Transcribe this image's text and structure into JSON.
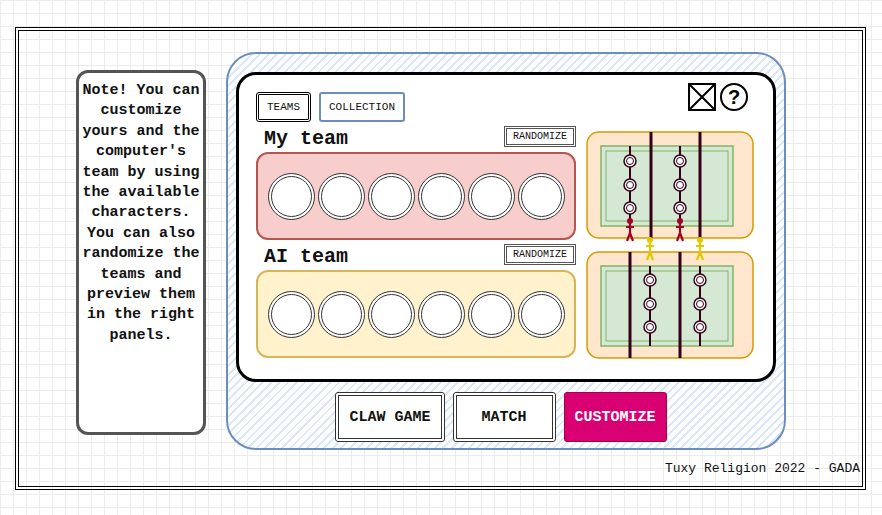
{
  "tabs": [
    {
      "label": "TEAMS",
      "selected": true
    },
    {
      "label": "COLLECTION",
      "selected": false
    }
  ],
  "help_button": "?",
  "note": "Note! You can customize yours and the computer's team by using the available characters. You can also randomize the teams and preview them in the right panels.",
  "teams": [
    {
      "title": "My team",
      "randomize": "RANDOMIZE",
      "color": "#a20025",
      "slots": [
        {
          "filled": false
        },
        {
          "filled": false
        },
        {
          "filled": false
        },
        {
          "filled": false
        },
        {
          "filled": false
        },
        {
          "filled": false
        }
      ]
    },
    {
      "title": "AI team",
      "randomize": "RANDOMIZE",
      "color": "#e3c800",
      "slots": [
        {
          "filled": false
        },
        {
          "filled": false
        },
        {
          "filled": false
        },
        {
          "filled": false
        },
        {
          "filled": false
        },
        {
          "filled": false
        }
      ]
    }
  ],
  "buttons": [
    {
      "label": "CLAW GAME",
      "selected": false
    },
    {
      "label": "MATCH",
      "selected": false
    },
    {
      "label": "CUSTOMIZE",
      "selected": true
    }
  ],
  "footer": "Tuxy Religion 2022 - GADA"
}
